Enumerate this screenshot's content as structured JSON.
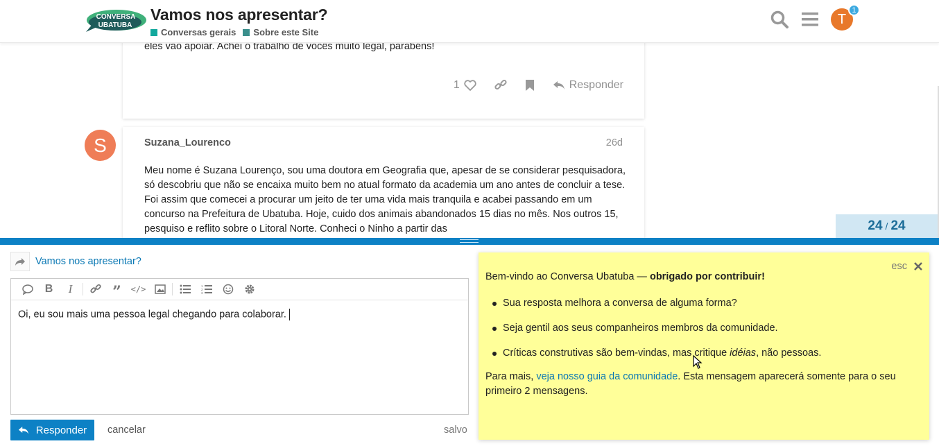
{
  "header": {
    "logo_text_line1": "CONVERSA",
    "logo_text_line2": "UBATUBA",
    "topic_title": "Vamos nos apresentar?",
    "categories": [
      {
        "label": "Conversas gerais",
        "color": "#12a89d"
      },
      {
        "label": "Sobre este Site",
        "color": "#3ab54a"
      }
    ],
    "avatar_letter": "T",
    "notification_count": "1"
  },
  "posts": {
    "post1": {
      "text_tail": "eles vão apoiar. Achei o trabalho de vocês muito legal, parabéns!",
      "like_count": "1",
      "reply_label": "Responder"
    },
    "post2": {
      "avatar_letter": "S",
      "username": "Suzana_Lourenco",
      "date": "26d",
      "body": "Meu nome é Suzana Lourenço, sou uma doutora em Geografia que, apesar de se considerar pesquisadora, só descobriu que não se encaixa muito bem no atual formato da academia um ano antes de concluir a tese. Foi assim que comecei a procurar um jeito de ter uma vida mais tranquila e acabei passando em um concurso na Prefeitura de Ubatuba. Hoje, cuido dos animais abandonados 15 dias no mês. Nos outros 15, pesquiso e reflito sobre o Litoral Norte. Conheci o Ninho a partir das"
    }
  },
  "progress": {
    "current": "24",
    "total": "24"
  },
  "composer": {
    "reply_to_title": "Vamos nos apresentar?",
    "editor_text": "Oi, eu sou mais uma pessoa legal chegando para colaborar.",
    "reply_button": "Responder",
    "cancel": "cancelar",
    "saved": "salvo"
  },
  "education": {
    "close_label": "esc",
    "intro_plain": "Bem-vindo ao Conversa Ubatuba — ",
    "intro_bold": "obrigado por contribuir!",
    "bullet1": "Sua resposta melhora a conversa de alguma forma?",
    "bullet2": "Seja gentil aos seus companheiros membros da comunidade.",
    "bullet3_pre": "Críticas construtivas são bem-vindas, mas critique ",
    "bullet3_em": "idéias",
    "bullet3_post": ", não pessoas.",
    "more_pre": "Para mais, ",
    "more_link": "veja nosso guia da comunidade",
    "more_post": ". Esta mensagem aparecerá somente para o seu primeiro 2 mensagens."
  },
  "colors": {
    "accent": "#0d81c5",
    "education_bg": "#ffff99",
    "progress_bg": "#d1e7f3"
  }
}
